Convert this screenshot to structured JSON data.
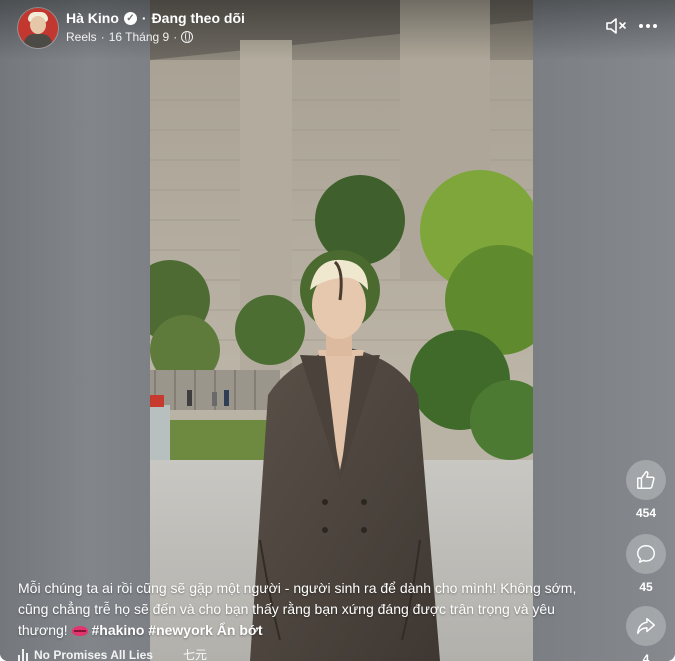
{
  "post": {
    "author": "Hà Kino",
    "follow_status": "Đang theo dõi",
    "source": "Reels",
    "date": "16 Tháng 9",
    "separator": "·"
  },
  "caption": {
    "text": "Mỗi chúng ta ai rồi cũng sẽ gặp một người - người sinh ra để dành cho mình! Không sớm, cũng chẳng trễ họ sẽ đến và cho bạn thấy rằng bạn xứng đáng được trân trọng và yêu thương!",
    "hashtags": [
      "#hakino",
      "#newyork"
    ],
    "see_less": "Ẩn bớt"
  },
  "music": {
    "title": "No Promises All Lies",
    "artist": "七元"
  },
  "actions": {
    "likes": "454",
    "comments": "45",
    "shares": "4"
  },
  "icons": {
    "mute": "muted-speaker-icon",
    "more": "more-options-icon",
    "like": "thumbs-up-icon",
    "comment": "comment-bubble-icon",
    "share": "share-arrow-icon",
    "music": "audio-wave-icon",
    "verified": "verified-badge-icon",
    "privacy": "globe-icon",
    "emoji": "kiss-lips-emoji"
  },
  "colors": {
    "overlay_gray": "#7e8287",
    "text": "#ffffff",
    "emoji_lips": "#e0356d"
  }
}
